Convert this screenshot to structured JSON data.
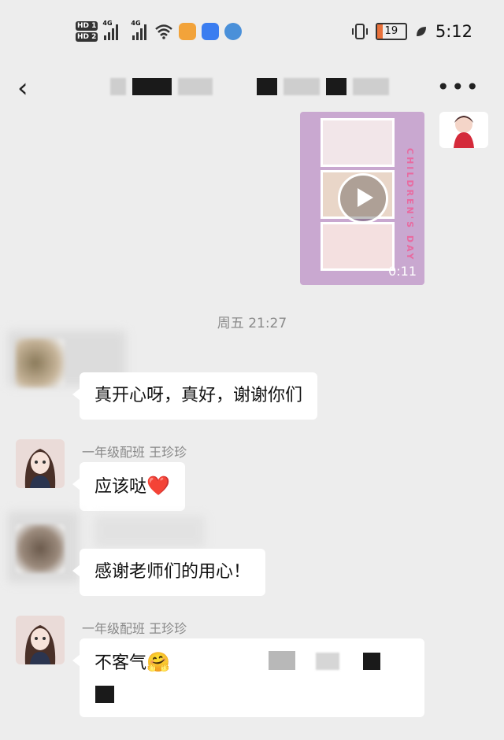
{
  "status": {
    "hd1": "HD 1",
    "hd2": "HD 2",
    "net1": "4G",
    "net2": "4G",
    "battery": "19",
    "time": "5:12"
  },
  "nav": {
    "back_glyph": "‹",
    "more_glyph": "•••"
  },
  "video": {
    "side_text": "CHILDREN'S DAY",
    "duration": "0:11"
  },
  "timestamp": "周五 21:27",
  "messages": [
    {
      "text": "真开心呀，真好，谢谢你们"
    },
    {
      "sender": "一年级配班  王珍珍",
      "text": "应该哒",
      "emoji": "❤️"
    },
    {
      "text": "感谢老师们的用心！"
    },
    {
      "sender": "一年级配班  王珍珍",
      "text": "不客气",
      "emoji": "🤗"
    }
  ]
}
